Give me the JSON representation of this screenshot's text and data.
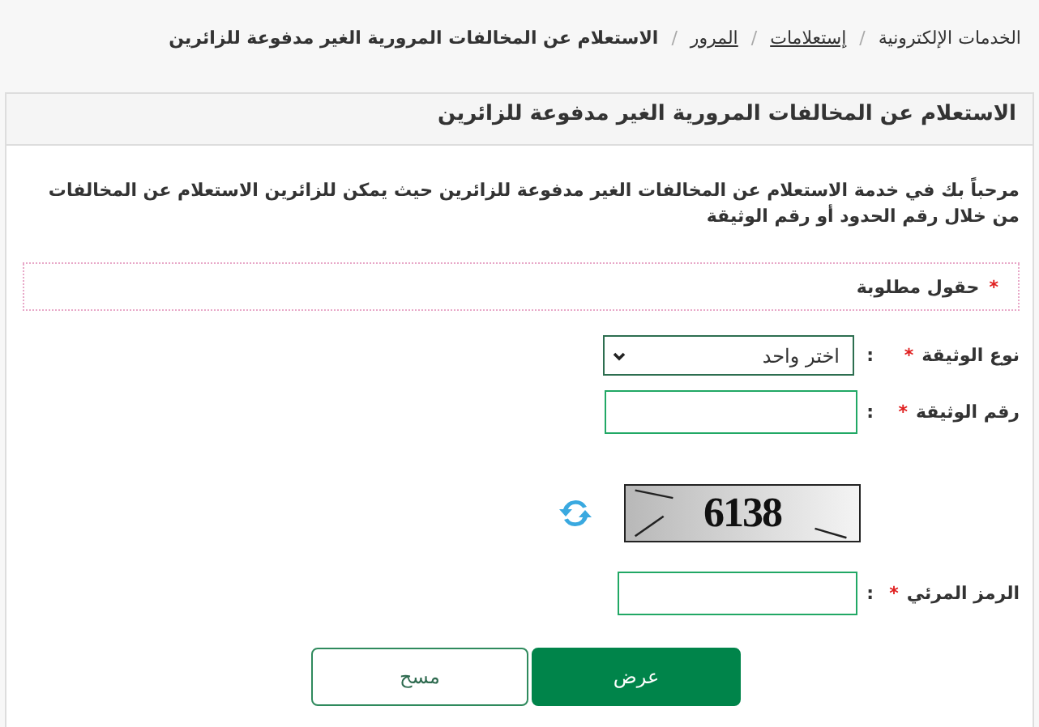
{
  "breadcrumb": [
    {
      "label": "الخدمات الإلكترونية",
      "link": false,
      "current": false
    },
    {
      "label": "إستعلامات",
      "link": true,
      "current": false
    },
    {
      "label": "المرور",
      "link": true,
      "current": false
    },
    {
      "label": "الاستعلام عن المخالفات المرورية الغير مدفوعة للزائرين",
      "link": false,
      "current": true
    }
  ],
  "breadcrumb_separator": "/",
  "panel": {
    "title": "الاستعلام عن المخالفات المرورية الغير مدفوعة للزائرين",
    "intro": "مرحباً بك في خدمة الاستعلام عن المخالفات الغير مدفوعة للزائرين حيث يمكن للزائرين الاستعلام عن المخالفات من خلال رقم الحدود أو رقم الوثيقة",
    "required_note": {
      "mark": "*",
      "text": "حقول مطلوبة"
    },
    "fields": [
      {
        "kind": "select",
        "label": "نوع الوثيقة",
        "required_mark": "*",
        "colon": ":",
        "value": "اختر واحد"
      },
      {
        "kind": "text",
        "label": "رقم الوثيقة",
        "required_mark": "*",
        "colon": ":"
      },
      {
        "kind": "captcha",
        "text": "6138"
      },
      {
        "kind": "text",
        "label": "الرمز المرئي",
        "required_mark": "*",
        "colon": ":"
      }
    ],
    "buttons": [
      {
        "label": "عرض",
        "primary": true
      },
      {
        "label": "مسح",
        "primary": false
      }
    ]
  }
}
